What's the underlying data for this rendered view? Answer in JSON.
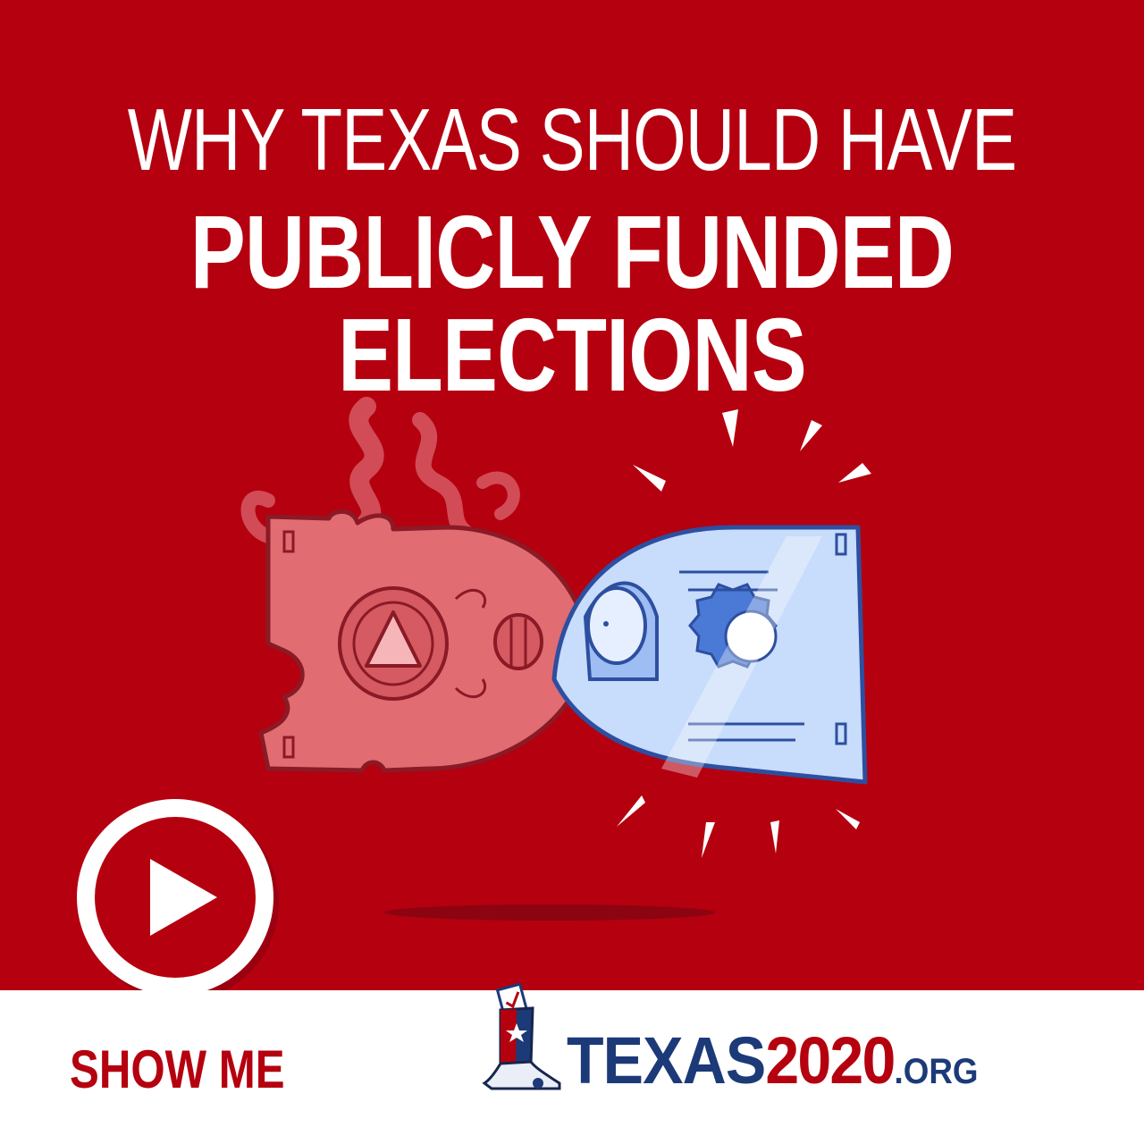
{
  "headline": {
    "line1": "WHY TEXAS SHOULD HAVE",
    "line2": "PUBLICLY FUNDED",
    "line3": "ELECTIONS"
  },
  "cta": {
    "label": "SHOW ME"
  },
  "logo": {
    "texas": "TEXAS",
    "year": "2020",
    "tld": ".ORG"
  },
  "colors": {
    "background_red": "#b5000f",
    "navy": "#1c3a78",
    "white": "#ffffff",
    "bill_red": "#e16c72",
    "bill_blue": "#c8dcfb"
  },
  "icons": {
    "play": "play-icon",
    "boot": "cowboy-boot-icon"
  }
}
